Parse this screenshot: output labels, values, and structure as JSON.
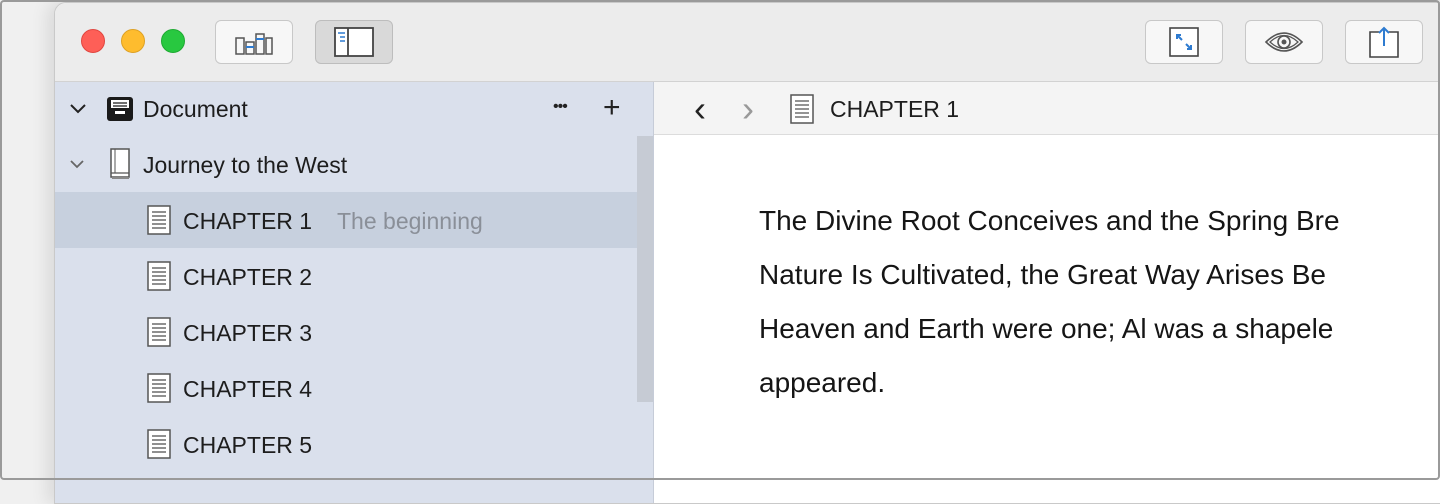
{
  "toolbar": {
    "left_buttons": [
      {
        "icon": "corkboard-icon"
      },
      {
        "icon": "sidebar-toggle-icon",
        "active": true
      }
    ],
    "right_buttons": [
      {
        "icon": "expand-icon"
      },
      {
        "icon": "eye-icon"
      },
      {
        "icon": "share-icon"
      }
    ]
  },
  "sidebar": {
    "root": {
      "label": "Document",
      "icon": "inbox-tray-icon",
      "more": "•••",
      "add": "+"
    },
    "book": {
      "label": "Journey to the West",
      "icon": "book-icon"
    },
    "chapters": [
      {
        "label": "CHAPTER 1",
        "note": "The beginning",
        "selected": true
      },
      {
        "label": "CHAPTER 2",
        "note": ""
      },
      {
        "label": "CHAPTER 3",
        "note": ""
      },
      {
        "label": "CHAPTER 4",
        "note": ""
      },
      {
        "label": "CHAPTER 5",
        "note": ""
      }
    ]
  },
  "navbar": {
    "back": "‹",
    "forward": "›",
    "title": "CHAPTER 1"
  },
  "editor": {
    "lines": [
      "The Divine Root Conceives and the Spring Bre",
      "Nature Is Cultivated, the Great Way Arises Be",
      "Heaven and Earth were one; Al was a shapele",
      "appeared."
    ]
  },
  "colors": {
    "sidebar_bg": "#dae0ec",
    "selected_row": "#c7d0de",
    "accent_icon": "#2e7bd0"
  }
}
